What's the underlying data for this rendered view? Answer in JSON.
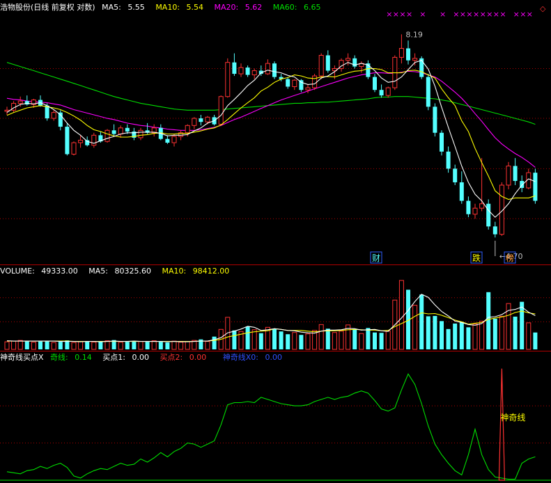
{
  "chart_data": [
    {
      "type": "candlestick",
      "title": "浩物股份(日线 前复权 对数)",
      "series_labels": [
        "MA5:",
        "MA10:",
        "MA20:",
        "MA60:"
      ],
      "series_values": [
        "5.55",
        "5.54",
        "5.62",
        "6.65"
      ],
      "colors": {
        "up": "#ff3232",
        "down": "#54ffff",
        "ma5": "#ffffff",
        "ma10": "#ffff00",
        "ma20": "#ff00ff",
        "ma60": "#00e000",
        "grid": "#b00000",
        "markers": "#ff00ff"
      },
      "ohlc": [
        [
          6.72,
          6.8,
          6.66,
          6.74
        ],
        [
          6.74,
          6.9,
          6.7,
          6.86
        ],
        [
          6.86,
          6.98,
          6.8,
          6.9
        ],
        [
          6.9,
          7.0,
          6.82,
          6.84
        ],
        [
          6.84,
          6.94,
          6.78,
          6.92
        ],
        [
          6.92,
          7.0,
          6.8,
          6.82
        ],
        [
          6.82,
          6.86,
          6.56,
          6.6
        ],
        [
          6.6,
          6.74,
          6.56,
          6.7
        ],
        [
          6.7,
          6.74,
          6.4,
          6.46
        ],
        [
          6.46,
          6.52,
          6.0,
          6.02
        ],
        [
          6.02,
          6.22,
          6.0,
          6.2
        ],
        [
          6.2,
          6.32,
          6.12,
          6.24
        ],
        [
          6.24,
          6.3,
          6.14,
          6.16
        ],
        [
          6.16,
          6.36,
          6.12,
          6.32
        ],
        [
          6.32,
          6.38,
          6.2,
          6.22
        ],
        [
          6.22,
          6.42,
          6.2,
          6.4
        ],
        [
          6.4,
          6.5,
          6.3,
          6.34
        ],
        [
          6.34,
          6.48,
          6.28,
          6.44
        ],
        [
          6.44,
          6.5,
          6.34,
          6.38
        ],
        [
          6.38,
          6.44,
          6.24,
          6.28
        ],
        [
          6.28,
          6.44,
          6.24,
          6.4
        ],
        [
          6.4,
          6.52,
          6.34,
          6.36
        ],
        [
          6.36,
          6.5,
          6.3,
          6.44
        ],
        [
          6.44,
          6.5,
          6.24,
          6.26
        ],
        [
          6.26,
          6.32,
          6.18,
          6.2
        ],
        [
          6.2,
          6.34,
          6.14,
          6.3
        ],
        [
          6.3,
          6.4,
          6.24,
          6.36
        ],
        [
          6.36,
          6.5,
          6.3,
          6.48
        ],
        [
          6.48,
          6.62,
          6.42,
          6.6
        ],
        [
          6.6,
          6.66,
          6.48,
          6.54
        ],
        [
          6.54,
          6.64,
          6.5,
          6.62
        ],
        [
          6.62,
          6.66,
          6.48,
          6.5
        ],
        [
          6.5,
          7.0,
          6.48,
          6.98
        ],
        [
          6.98,
          7.7,
          6.96,
          7.62
        ],
        [
          7.62,
          7.8,
          7.36,
          7.4
        ],
        [
          7.4,
          7.6,
          7.34,
          7.52
        ],
        [
          7.52,
          7.56,
          7.34,
          7.38
        ],
        [
          7.38,
          7.5,
          7.3,
          7.46
        ],
        [
          7.46,
          7.56,
          7.36,
          7.4
        ],
        [
          7.4,
          7.68,
          7.38,
          7.6
        ],
        [
          7.6,
          7.64,
          7.3,
          7.34
        ],
        [
          7.34,
          7.4,
          7.26,
          7.3
        ],
        [
          7.3,
          7.34,
          7.12,
          7.16
        ],
        [
          7.16,
          7.3,
          7.1,
          7.28
        ],
        [
          7.28,
          7.3,
          7.06,
          7.1
        ],
        [
          7.1,
          7.2,
          7.04,
          7.14
        ],
        [
          7.14,
          7.4,
          7.1,
          7.36
        ],
        [
          7.36,
          7.8,
          7.3,
          7.76
        ],
        [
          7.76,
          7.86,
          7.42,
          7.46
        ],
        [
          7.46,
          7.56,
          7.3,
          7.5
        ],
        [
          7.5,
          7.7,
          7.44,
          7.66
        ],
        [
          7.66,
          7.8,
          7.56,
          7.7
        ],
        [
          7.7,
          7.76,
          7.5,
          7.54
        ],
        [
          7.54,
          7.64,
          7.42,
          7.6
        ],
        [
          7.6,
          7.66,
          7.3,
          7.34
        ],
        [
          7.34,
          7.4,
          7.06,
          7.1
        ],
        [
          7.1,
          7.2,
          6.96,
          7.0
        ],
        [
          7.0,
          7.16,
          6.96,
          7.14
        ],
        [
          7.14,
          7.76,
          7.1,
          7.72
        ],
        [
          7.72,
          8.19,
          7.6,
          7.9
        ],
        [
          7.9,
          8.06,
          7.58,
          7.66
        ],
        [
          7.66,
          7.8,
          7.56,
          7.7
        ],
        [
          7.7,
          7.74,
          7.3,
          7.34
        ],
        [
          7.34,
          7.4,
          6.74,
          6.8
        ],
        [
          6.8,
          6.86,
          6.3,
          6.36
        ],
        [
          6.36,
          6.4,
          6.0,
          6.06
        ],
        [
          6.06,
          6.14,
          5.74,
          5.8
        ],
        [
          5.8,
          5.86,
          5.56,
          5.6
        ],
        [
          5.6,
          5.76,
          5.3,
          5.34
        ],
        [
          5.34,
          5.4,
          5.12,
          5.16
        ],
        [
          5.16,
          5.3,
          5.1,
          5.24
        ],
        [
          5.24,
          5.96,
          5.2,
          5.3
        ],
        [
          5.3,
          5.36,
          4.96,
          5.0
        ],
        [
          5.0,
          5.06,
          4.86,
          4.9
        ],
        [
          4.9,
          5.6,
          4.88,
          5.56
        ],
        [
          5.56,
          5.9,
          5.5,
          5.84
        ],
        [
          5.84,
          5.96,
          5.56,
          5.62
        ],
        [
          5.62,
          5.7,
          5.46,
          5.52
        ],
        [
          5.52,
          5.8,
          5.5,
          5.74
        ],
        [
          5.74,
          5.8,
          5.3,
          5.34
        ]
      ],
      "ma5": [
        6.7,
        6.78,
        6.84,
        6.86,
        6.85,
        6.87,
        6.82,
        6.75,
        6.66,
        6.52,
        6.4,
        6.32,
        6.22,
        6.19,
        6.23,
        6.27,
        6.3,
        6.34,
        6.36,
        6.36,
        6.37,
        6.37,
        6.37,
        6.35,
        6.31,
        6.32,
        6.32,
        6.33,
        6.39,
        6.44,
        6.52,
        6.56,
        6.65,
        6.82,
        6.93,
        7.05,
        7.18,
        7.28,
        7.42,
        7.47,
        7.44,
        7.42,
        7.37,
        7.34,
        7.24,
        7.2,
        7.21,
        7.32,
        7.36,
        7.44,
        7.55,
        7.62,
        7.57,
        7.6,
        7.57,
        7.46,
        7.32,
        7.24,
        7.26,
        7.34,
        7.48,
        7.62,
        7.66,
        7.49,
        7.17,
        6.79,
        6.45,
        6.14,
        5.84,
        5.6,
        5.43,
        5.34,
        5.21,
        5.12,
        5.2,
        5.3,
        5.44,
        5.56,
        5.65,
        5.61
      ],
      "ma10": [
        6.65,
        6.7,
        6.74,
        6.78,
        6.8,
        6.82,
        6.8,
        6.78,
        6.75,
        6.7,
        6.64,
        6.57,
        6.48,
        6.41,
        6.38,
        6.34,
        6.31,
        6.29,
        6.29,
        6.3,
        6.32,
        6.33,
        6.35,
        6.36,
        6.34,
        6.34,
        6.35,
        6.35,
        6.37,
        6.39,
        6.42,
        6.44,
        6.49,
        6.58,
        6.68,
        6.78,
        6.87,
        6.96,
        7.08,
        7.15,
        7.24,
        7.3,
        7.33,
        7.38,
        7.36,
        7.32,
        7.31,
        7.34,
        7.35,
        7.34,
        7.38,
        7.42,
        7.45,
        7.46,
        7.5,
        7.5,
        7.48,
        7.42,
        7.42,
        7.42,
        7.46,
        7.47,
        7.44,
        7.38,
        7.32,
        7.12,
        6.96,
        6.82,
        6.56,
        6.38,
        6.11,
        5.89,
        5.69,
        5.48,
        5.4,
        5.36,
        5.38,
        5.38,
        5.38,
        5.41
      ],
      "ma20": [
        6.95,
        6.93,
        6.92,
        6.9,
        6.89,
        6.88,
        6.87,
        6.85,
        6.83,
        6.79,
        6.75,
        6.72,
        6.69,
        6.66,
        6.63,
        6.6,
        6.58,
        6.55,
        6.52,
        6.5,
        6.48,
        6.47,
        6.45,
        6.44,
        6.42,
        6.41,
        6.4,
        6.4,
        6.4,
        6.41,
        6.43,
        6.45,
        6.48,
        6.53,
        6.58,
        6.62,
        6.67,
        6.72,
        6.77,
        6.82,
        6.87,
        6.92,
        6.96,
        7.0,
        7.04,
        7.08,
        7.12,
        7.16,
        7.2,
        7.24,
        7.28,
        7.32,
        7.35,
        7.38,
        7.4,
        7.42,
        7.42,
        7.41,
        7.41,
        7.43,
        7.45,
        7.44,
        7.42,
        7.38,
        7.34,
        7.26,
        7.16,
        7.06,
        6.95,
        6.82,
        6.68,
        6.55,
        6.41,
        6.28,
        6.18,
        6.1,
        6.03,
        5.97,
        5.9,
        5.82
      ],
      "ma60": [
        7.62,
        7.58,
        7.54,
        7.5,
        7.46,
        7.42,
        7.38,
        7.34,
        7.3,
        7.26,
        7.22,
        7.18,
        7.14,
        7.1,
        7.06,
        7.02,
        6.98,
        6.95,
        6.92,
        6.89,
        6.86,
        6.84,
        6.82,
        6.8,
        6.78,
        6.76,
        6.75,
        6.74,
        6.74,
        6.74,
        6.74,
        6.74,
        6.75,
        6.76,
        6.77,
        6.78,
        6.79,
        6.8,
        6.81,
        6.82,
        6.83,
        6.84,
        6.85,
        6.86,
        6.86,
        6.87,
        6.87,
        6.88,
        6.88,
        6.89,
        6.9,
        6.91,
        6.92,
        6.93,
        6.94,
        6.96,
        6.97,
        6.97,
        6.98,
        6.98,
        6.98,
        6.97,
        6.96,
        6.95,
        6.94,
        6.92,
        6.9,
        6.87,
        6.84,
        6.81,
        6.78,
        6.75,
        6.72,
        6.69,
        6.66,
        6.63,
        6.6,
        6.57,
        6.54,
        6.5
      ],
      "high_label": "8.19",
      "low_label": "4.70",
      "annotations": [
        "财",
        "跌",
        "榜"
      ],
      "marker_glyph": "×",
      "marker_bars": [
        57,
        58,
        59,
        60,
        62,
        65,
        67,
        68,
        69,
        70,
        71,
        72,
        73,
        74,
        76,
        77,
        78
      ],
      "diamond_glyph": "◇",
      "ylim": [
        4.6,
        8.6
      ],
      "log_scale": true
    },
    {
      "type": "bar",
      "title": "VOLUME:",
      "series_labels": [
        "VOLUME:",
        "MA5:",
        "MA10:"
      ],
      "series_values": [
        "49333.00",
        "80325.60",
        "98412.00"
      ],
      "volume": [
        22,
        24,
        26,
        25,
        21,
        23,
        25,
        20,
        22,
        26,
        20,
        23,
        24,
        21,
        22,
        25,
        27,
        21,
        22,
        24,
        23,
        22,
        25,
        22,
        20,
        24,
        21,
        23,
        26,
        29,
        23,
        37,
        58,
        93,
        55,
        52,
        66,
        57,
        47,
        64,
        59,
        52,
        44,
        49,
        42,
        45,
        55,
        72,
        60,
        49,
        53,
        71,
        59,
        46,
        62,
        49,
        48,
        53,
        143,
        200,
        173,
        128,
        159,
        96,
        97,
        82,
        59,
        75,
        80,
        64,
        74,
        82,
        166,
        89,
        96,
        133,
        95,
        138,
        77,
        49
      ],
      "vol_ma5": [
        25,
        24,
        24,
        24,
        24,
        24,
        24,
        24,
        23,
        23,
        23,
        22,
        23,
        23,
        22,
        23,
        24,
        23,
        23,
        24,
        23,
        23,
        23,
        23,
        22,
        23,
        22,
        22,
        23,
        24,
        24,
        28,
        34,
        48,
        53,
        59,
        67,
        64,
        55,
        57,
        60,
        58,
        55,
        54,
        50,
        48,
        47,
        53,
        56,
        56,
        57,
        61,
        60,
        56,
        57,
        58,
        54,
        52,
        71,
        91,
        113,
        139,
        160,
        151,
        129,
        110,
        97,
        82,
        78,
        72,
        70,
        75,
        93,
        95,
        101,
        113,
        116,
        123,
        108,
        98
      ],
      "vol_ma10": [
        24,
        24,
        24,
        24,
        24,
        24,
        24,
        24,
        24,
        24,
        23,
        23,
        23,
        23,
        23,
        23,
        23,
        23,
        23,
        23,
        23,
        23,
        23,
        23,
        23,
        23,
        23,
        23,
        23,
        24,
        24,
        26,
        29,
        36,
        40,
        44,
        48,
        51,
        53,
        54,
        60,
        58,
        55,
        55,
        55,
        53,
        51,
        53,
        54,
        54,
        55,
        57,
        58,
        57,
        56,
        56,
        54,
        55,
        66,
        75,
        84,
        96,
        106,
        103,
        104,
        99,
        92,
        85,
        80,
        73,
        76,
        78,
        87,
        91,
        94,
        99,
        107,
        111,
        106,
        103
      ],
      "ylim": [
        0,
        210
      ]
    },
    {
      "type": "line",
      "title": "神奇线买点X",
      "series_labels": [
        "奇线:",
        "买点1:",
        "买点2:",
        "神奇线X0:"
      ],
      "series_values": [
        "0.14",
        "0.00",
        "0.00",
        "0.00"
      ],
      "line": [
        0.08,
        0.07,
        0.06,
        0.09,
        0.1,
        0.13,
        0.11,
        0.14,
        0.16,
        0.12,
        0.04,
        0.02,
        0.06,
        0.09,
        0.11,
        0.1,
        0.13,
        0.16,
        0.14,
        0.15,
        0.2,
        0.17,
        0.21,
        0.26,
        0.22,
        0.27,
        0.3,
        0.35,
        0.34,
        0.31,
        0.34,
        0.37,
        0.52,
        0.71,
        0.73,
        0.73,
        0.74,
        0.73,
        0.78,
        0.76,
        0.74,
        0.72,
        0.71,
        0.7,
        0.7,
        0.71,
        0.74,
        0.76,
        0.78,
        0.76,
        0.78,
        0.79,
        0.82,
        0.84,
        0.82,
        0.75,
        0.67,
        0.65,
        0.68,
        0.85,
        1.0,
        0.9,
        0.72,
        0.51,
        0.34,
        0.24,
        0.16,
        0.09,
        0.05,
        0.24,
        0.48,
        0.24,
        0.1,
        0.03,
        0.02,
        0.01,
        0.01,
        0.16,
        0.2,
        0.22
      ],
      "signal_label": "神奇线",
      "signal_bar": 74,
      "ylim": [
        0,
        1.1
      ]
    }
  ]
}
